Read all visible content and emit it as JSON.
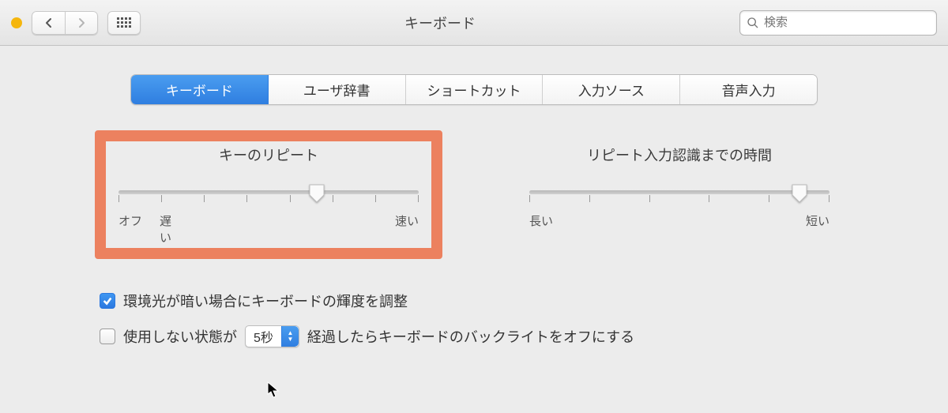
{
  "window": {
    "title": "キーボード"
  },
  "search": {
    "placeholder": "検索"
  },
  "tabs": [
    {
      "label": "キーボード",
      "active": true
    },
    {
      "label": "ユーザ辞書",
      "active": false
    },
    {
      "label": "ショートカット",
      "active": false
    },
    {
      "label": "入力ソース",
      "active": false
    },
    {
      "label": "音声入力",
      "active": false
    }
  ],
  "sliders": {
    "key_repeat": {
      "title": "キーのリピート",
      "ticks": 8,
      "knob_pct": 66,
      "left_label": "オフ",
      "second_label": "遅い",
      "right_label": "速い"
    },
    "delay_until_repeat": {
      "title": "リピート入力認識までの時間",
      "ticks": 6,
      "knob_pct": 90,
      "left_label": "長い",
      "right_label": "短い"
    }
  },
  "options": {
    "adjust_brightness": {
      "checked": true,
      "label": "環境光が暗い場合にキーボードの輝度を調整"
    },
    "backlight_off": {
      "checked": false,
      "prefix": "使用しない状態が",
      "select_value": "5秒",
      "suffix": "経過したらキーボードのバックライトをオフにする"
    }
  }
}
